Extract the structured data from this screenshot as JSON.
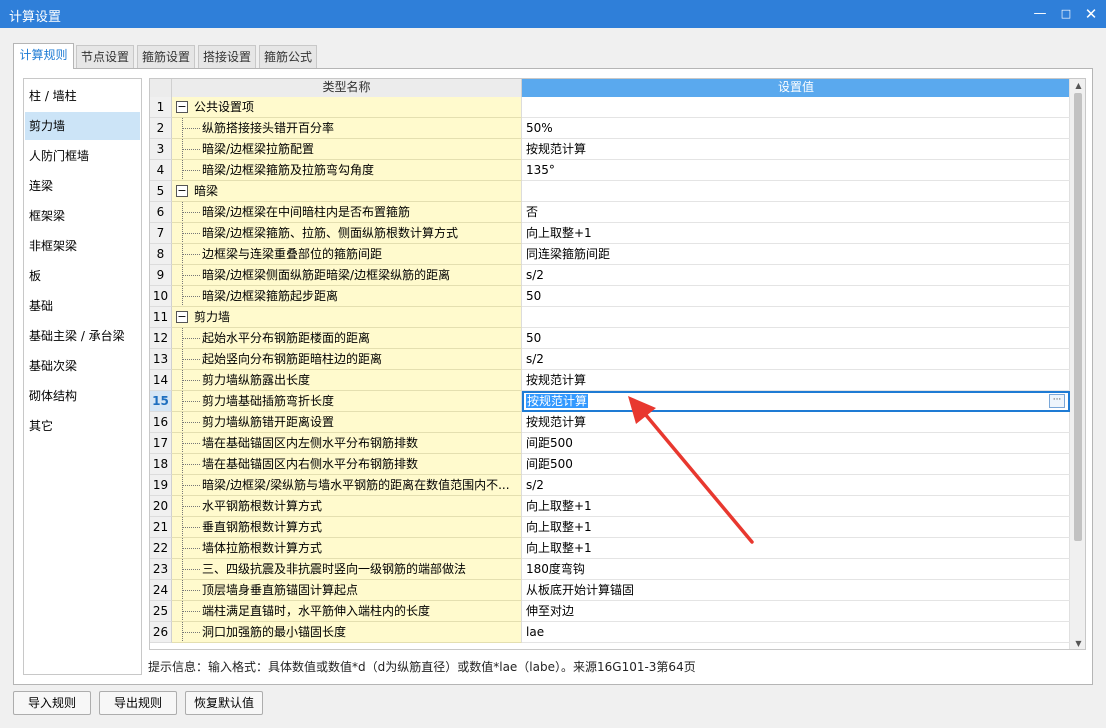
{
  "window": {
    "title": "计算设置",
    "min": "—",
    "max": "□",
    "close": "✕"
  },
  "tabs": [
    "计算规则",
    "节点设置",
    "箍筋设置",
    "搭接设置",
    "箍筋公式"
  ],
  "sidebar": {
    "items": [
      "柱 / 墙柱",
      "剪力墙",
      "人防门框墙",
      "连梁",
      "框架梁",
      "非框架梁",
      "板",
      "基础",
      "基础主梁 / 承台梁",
      "基础次梁",
      "砌体结构",
      "其它"
    ]
  },
  "grid": {
    "headers": {
      "name": "类型名称",
      "value": "设置值"
    },
    "rows": [
      {
        "num": "1",
        "name": "公共设置项",
        "value": "",
        "group": true
      },
      {
        "num": "2",
        "name": "纵筋搭接接头错开百分率",
        "value": "50%"
      },
      {
        "num": "3",
        "name": "暗梁/边框梁拉筋配置",
        "value": "按规范计算"
      },
      {
        "num": "4",
        "name": "暗梁/边框梁箍筋及拉筋弯勾角度",
        "value": "135°"
      },
      {
        "num": "5",
        "name": "暗梁",
        "value": "",
        "group": true
      },
      {
        "num": "6",
        "name": "暗梁/边框梁在中间暗柱内是否布置箍筋",
        "value": "否"
      },
      {
        "num": "7",
        "name": "暗梁/边框梁箍筋、拉筋、侧面纵筋根数计算方式",
        "value": "向上取整+1"
      },
      {
        "num": "8",
        "name": "边框梁与连梁重叠部位的箍筋间距",
        "value": "同连梁箍筋间距"
      },
      {
        "num": "9",
        "name": "暗梁/边框梁侧面纵筋距暗梁/边框梁纵筋的距离",
        "value": "s/2"
      },
      {
        "num": "10",
        "name": "暗梁/边框梁箍筋起步距离",
        "value": "50"
      },
      {
        "num": "11",
        "name": "剪力墙",
        "value": "",
        "group": true
      },
      {
        "num": "12",
        "name": "起始水平分布钢筋距楼面的距离",
        "value": "50"
      },
      {
        "num": "13",
        "name": "起始竖向分布钢筋距暗柱边的距离",
        "value": "s/2"
      },
      {
        "num": "14",
        "name": "剪力墙纵筋露出长度",
        "value": "按规范计算"
      },
      {
        "num": "15",
        "name": "剪力墙基础插筋弯折长度",
        "value": "按规范计算",
        "current": true
      },
      {
        "num": "16",
        "name": "剪力墙纵筋错开距离设置",
        "value": "按规范计算"
      },
      {
        "num": "17",
        "name": "墙在基础锚固区内左侧水平分布钢筋排数",
        "value": "间距500"
      },
      {
        "num": "18",
        "name": "墙在基础锚固区内右侧水平分布钢筋排数",
        "value": "间距500"
      },
      {
        "num": "19",
        "name": "暗梁/边框梁/梁纵筋与墙水平钢筋的距离在数值范围内不...",
        "value": "s/2"
      },
      {
        "num": "20",
        "name": "水平钢筋根数计算方式",
        "value": "向上取整+1"
      },
      {
        "num": "21",
        "name": "垂直钢筋根数计算方式",
        "value": "向上取整+1"
      },
      {
        "num": "22",
        "name": "墙体拉筋根数计算方式",
        "value": "向上取整+1"
      },
      {
        "num": "23",
        "name": "三、四级抗震及非抗震时竖向一级钢筋的端部做法",
        "value": "180度弯钩"
      },
      {
        "num": "24",
        "name": "顶层墙身垂直筋锚固计算起点",
        "value": "从板底开始计算锚固"
      },
      {
        "num": "25",
        "name": "端柱满足直锚时，水平筋伸入端柱内的长度",
        "value": "伸至对边"
      },
      {
        "num": "26",
        "name": "洞口加强筋的最小锚固长度",
        "value": "lae"
      }
    ],
    "ellipsis": "···"
  },
  "hint": "提示信息：输入格式：具体数值或数值*d（d为纵筋直径）或数值*lae（labe）。来源16G101-3第64页",
  "buttons": {
    "import": "导入规则",
    "export": "导出规则",
    "restore": "恢复默认值"
  },
  "colors": {
    "title_bar": "#2f7fd9",
    "header_value": "#5aa9ee",
    "name_cell": "#fffacd",
    "annotation_arrow": "#e8382f"
  }
}
